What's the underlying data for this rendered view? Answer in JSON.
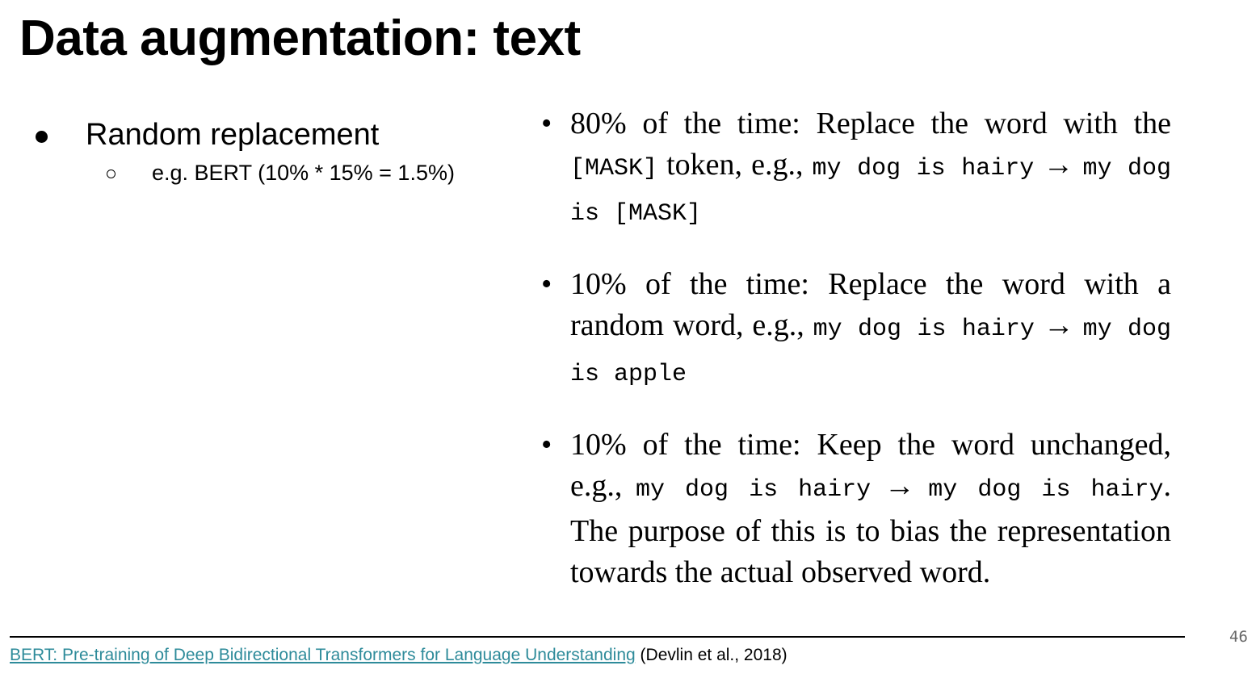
{
  "slide": {
    "title": "Data augmentation: text",
    "bullets": {
      "level1": "Random replacement",
      "level2": "e.g. BERT (10% * 15% = 1.5%)"
    },
    "bullet_glyph": "•",
    "paper_excerpt": [
      {
        "lead": "80% of the time: Replace the word with the ",
        "lead_code": "[MASK]",
        "mid": " token, e.g., ",
        "example_from": "my dog is hairy",
        "arrow": "→",
        "example_to": "my dog is [MASK]",
        "tail": ""
      },
      {
        "lead": "10% of the time: Replace the word with a random word, e.g., ",
        "lead_code": "",
        "mid": "",
        "example_from": "my dog is hairy",
        "arrow": "→",
        "example_to": "my dog is apple",
        "tail": ""
      },
      {
        "lead": "10% of the time: Keep the word unchanged, e.g., ",
        "lead_code": "",
        "mid": "",
        "example_from": "my dog is hairy",
        "arrow": "→",
        "example_to": "my dog is hairy",
        "tail": ". The purpose of this is to bias the representation towards the actual observed word."
      }
    ],
    "footer": {
      "link_text": "BERT: Pre-training of Deep Bidirectional Transformers for Language Understanding",
      "citation": " (Devlin et al., 2018)"
    },
    "page_number": "46",
    "colors": {
      "link": "#2e8b9a",
      "page_number": "#666666"
    }
  }
}
